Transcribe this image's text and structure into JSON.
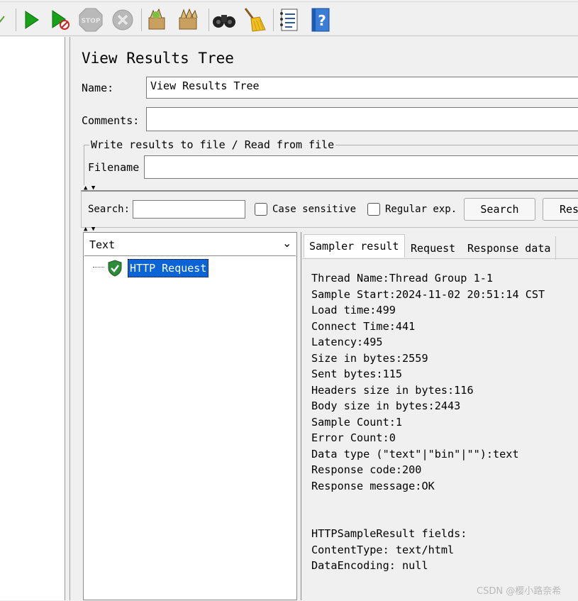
{
  "toolbar": {
    "icons": [
      "check-icon",
      "start-icon",
      "start-no-pauses-icon",
      "stop-icon",
      "shutdown-icon",
      "clear-icon",
      "clear-all-icon",
      "search-binoculars-icon",
      "reset-search-broom-icon",
      "function-helper-icon",
      "help-icon"
    ]
  },
  "panel": {
    "title": "View Results Tree",
    "name_label": "Name:",
    "name_value": "View Results Tree",
    "comments_label": "Comments:",
    "comments_value": "",
    "file_group_title": "Write results to file / Read from file",
    "filename_label": "Filename",
    "filename_value": ""
  },
  "search": {
    "label": "Search:",
    "value": "",
    "case_sensitive_label": "Case sensitive",
    "regular_exp_label": "Regular exp.",
    "search_button": "Search",
    "reset_button": "Res"
  },
  "renderer": {
    "selected": "Text"
  },
  "tree": {
    "items": [
      {
        "label": "HTTP Request",
        "status": "success"
      }
    ]
  },
  "tabs": [
    {
      "label": "Sampler result",
      "active": true
    },
    {
      "label": "Request",
      "active": false
    },
    {
      "label": "Response data",
      "active": false
    }
  ],
  "sampler_result": {
    "lines": [
      "Thread Name:Thread Group 1-1",
      "Sample Start:2024-11-02 20:51:14 CST",
      "Load time:499",
      "Connect Time:441",
      "Latency:495",
      "Size in bytes:2559",
      "Sent bytes:115",
      "Headers size in bytes:116",
      "Body size in bytes:2443",
      "Sample Count:1",
      "Error Count:0",
      "Data type (\"text\"|\"bin\"|\"\"):text",
      "Response code:200",
      "Response message:OK",
      "",
      "",
      "HTTPSampleResult fields:",
      "ContentType: text/html",
      "DataEncoding: null"
    ]
  },
  "watermark": "CSDN @樱小路奈希",
  "colors": {
    "selection": "#0a64d6",
    "success_green": "#2e8b3a",
    "start_green": "#1a9b1a"
  }
}
